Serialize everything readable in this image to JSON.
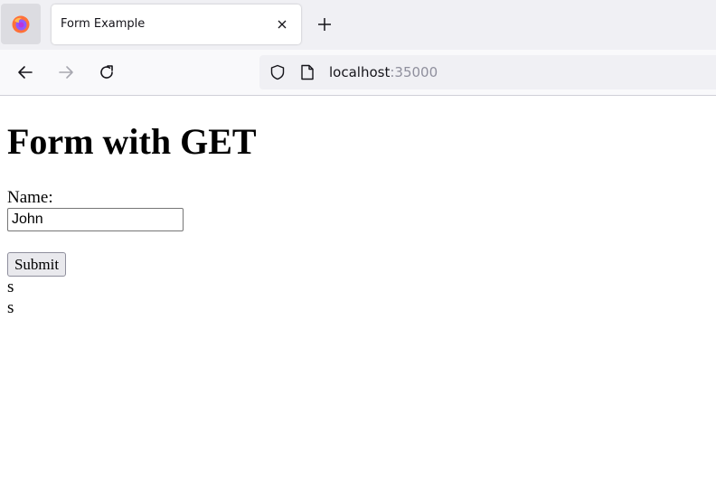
{
  "browser": {
    "tab": {
      "title": "Form Example"
    },
    "url": {
      "host": "localhost",
      "port": ":35000"
    },
    "icons": {
      "app": "firefox-icon",
      "close": "close-icon",
      "new_tab": "plus-icon",
      "back": "back-arrow-icon",
      "forward": "forward-arrow-icon",
      "reload": "reload-icon",
      "tracking": "shield-icon",
      "page": "page-icon"
    }
  },
  "page": {
    "heading": "Form with GET",
    "form": {
      "name_label": "Name:",
      "name_value": "John",
      "submit_label": "Submit"
    },
    "results": [
      "s",
      "s"
    ]
  },
  "colors": {
    "tabstrip_bg": "#f0f0f4",
    "navbar_bg": "#f9f9fb",
    "port_text": "#8f8f9d"
  }
}
